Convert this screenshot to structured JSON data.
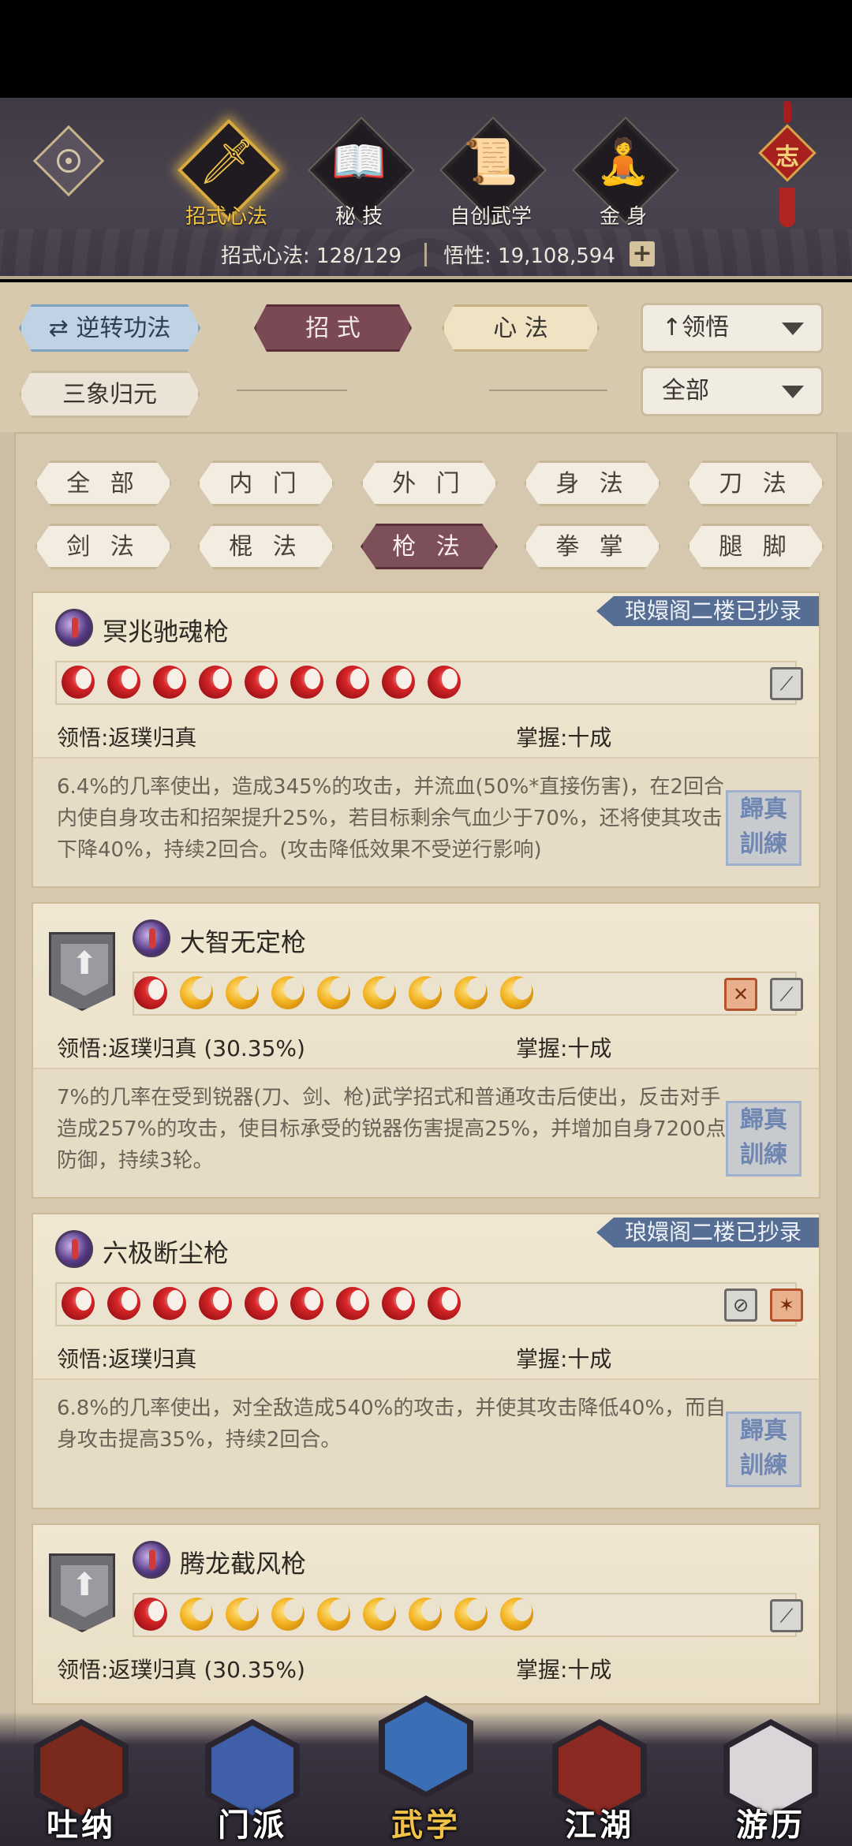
{
  "top_tabs": [
    {
      "label": "招式心法",
      "icon": "sword-icon",
      "glyph": "🗡"
    },
    {
      "label": "秘 技",
      "icon": "book-icon",
      "glyph": "📖"
    },
    {
      "label": "自创武学",
      "icon": "scroll-icon",
      "glyph": "📜"
    },
    {
      "label": "金 身",
      "icon": "meditation-icon",
      "glyph": "🧘"
    }
  ],
  "seal": {
    "char": "志"
  },
  "stats": {
    "skills": "招式心法: 128/129",
    "insight": "悟性: 19,108,594",
    "plus": "+"
  },
  "filters": {
    "reverse": "逆转功法",
    "tab_moves": "招 式",
    "tab_heart": "心 法",
    "sort": "领悟",
    "three": "三象归元",
    "range": "全部"
  },
  "categories": [
    "全 部",
    "内 门",
    "外 门",
    "身 法",
    "刀 法",
    "剑 法",
    "棍 法",
    "枪 法",
    "拳 掌",
    "腿 脚"
  ],
  "skills": [
    {
      "name": "冥兆驰魂枪",
      "ribbon": "琅嬛阁二楼已抄录",
      "points": [
        "full",
        "full",
        "full",
        "full",
        "full",
        "full",
        "full",
        "full",
        "full"
      ],
      "insight": "领悟:返璞归真",
      "mastery": "掌握:十成",
      "desc": [
        "6.4%的几率使出，造成345%的攻击，并流血(50%*直接伤害)，在2回合",
        "内使自身攻击和招架提升25%，若目标剩余气血少于70%，还将使其攻击",
        "下降40%，持续2回合。(攻击降低效果不受逆行影响)"
      ]
    },
    {
      "name": "大智无定枪",
      "ribbon": "",
      "points": [
        "full",
        "crescent",
        "crescent",
        "crescent",
        "crescent",
        "crescent",
        "crescent",
        "crescent",
        "crescent"
      ],
      "insight": "领悟:返璞归真 (30.35%)",
      "mastery": "掌握:十成",
      "desc": [
        "7%的几率在受到锐器(刀、剑、枪)武学招式和普通攻击后使出，反击对手",
        "造成257%的攻击，使目标承受的锐器伤害提高25%，并增加自身7200点",
        "防御，持续3轮。"
      ]
    },
    {
      "name": "六极断尘枪",
      "ribbon": "琅嬛阁二楼已抄录",
      "points": [
        "full",
        "full",
        "full",
        "full",
        "full",
        "full",
        "full",
        "full",
        "full"
      ],
      "insight": "领悟:返璞归真",
      "mastery": "掌握:十成",
      "desc": [
        "6.8%的几率使出，对全敌造成540%的攻击，并使其攻击降低40%，而自",
        "身攻击提高35%，持续2回合。"
      ]
    },
    {
      "name": "腾龙截风枪",
      "ribbon": "",
      "points": [
        "full",
        "crescent",
        "crescent",
        "crescent",
        "crescent",
        "crescent",
        "crescent",
        "crescent",
        "crescent"
      ],
      "insight": "领悟:返璞归真 (30.35%)",
      "mastery": "掌握:十成",
      "desc": []
    }
  ],
  "stamp": "歸真 訓練",
  "bottom_nav": [
    {
      "label": "吐纳",
      "icon": "monk-icon",
      "color": "#7a2a1c"
    },
    {
      "label": "门派",
      "icon": "banner-icon",
      "color": "#3f5fa8"
    },
    {
      "label": "武学",
      "icon": "manual-icon",
      "color": "#3b6fb5"
    },
    {
      "label": "江湖",
      "icon": "hat-icon",
      "color": "#8a2a22"
    },
    {
      "label": "游历",
      "icon": "horse-icon",
      "color": "#d9d5d8"
    }
  ]
}
